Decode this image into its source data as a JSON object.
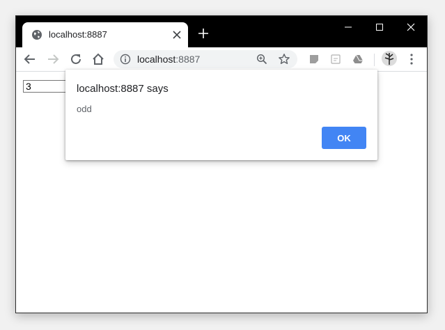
{
  "tab": {
    "title": "localhost:8887"
  },
  "omnibox": {
    "host": "localhost",
    "port": ":8887"
  },
  "page": {
    "input_value": "3"
  },
  "dialog": {
    "title": "localhost:8887 says",
    "message": "odd",
    "ok_label": "OK"
  },
  "colors": {
    "ok_button": "#4285f4",
    "titlebar": "#000000"
  }
}
